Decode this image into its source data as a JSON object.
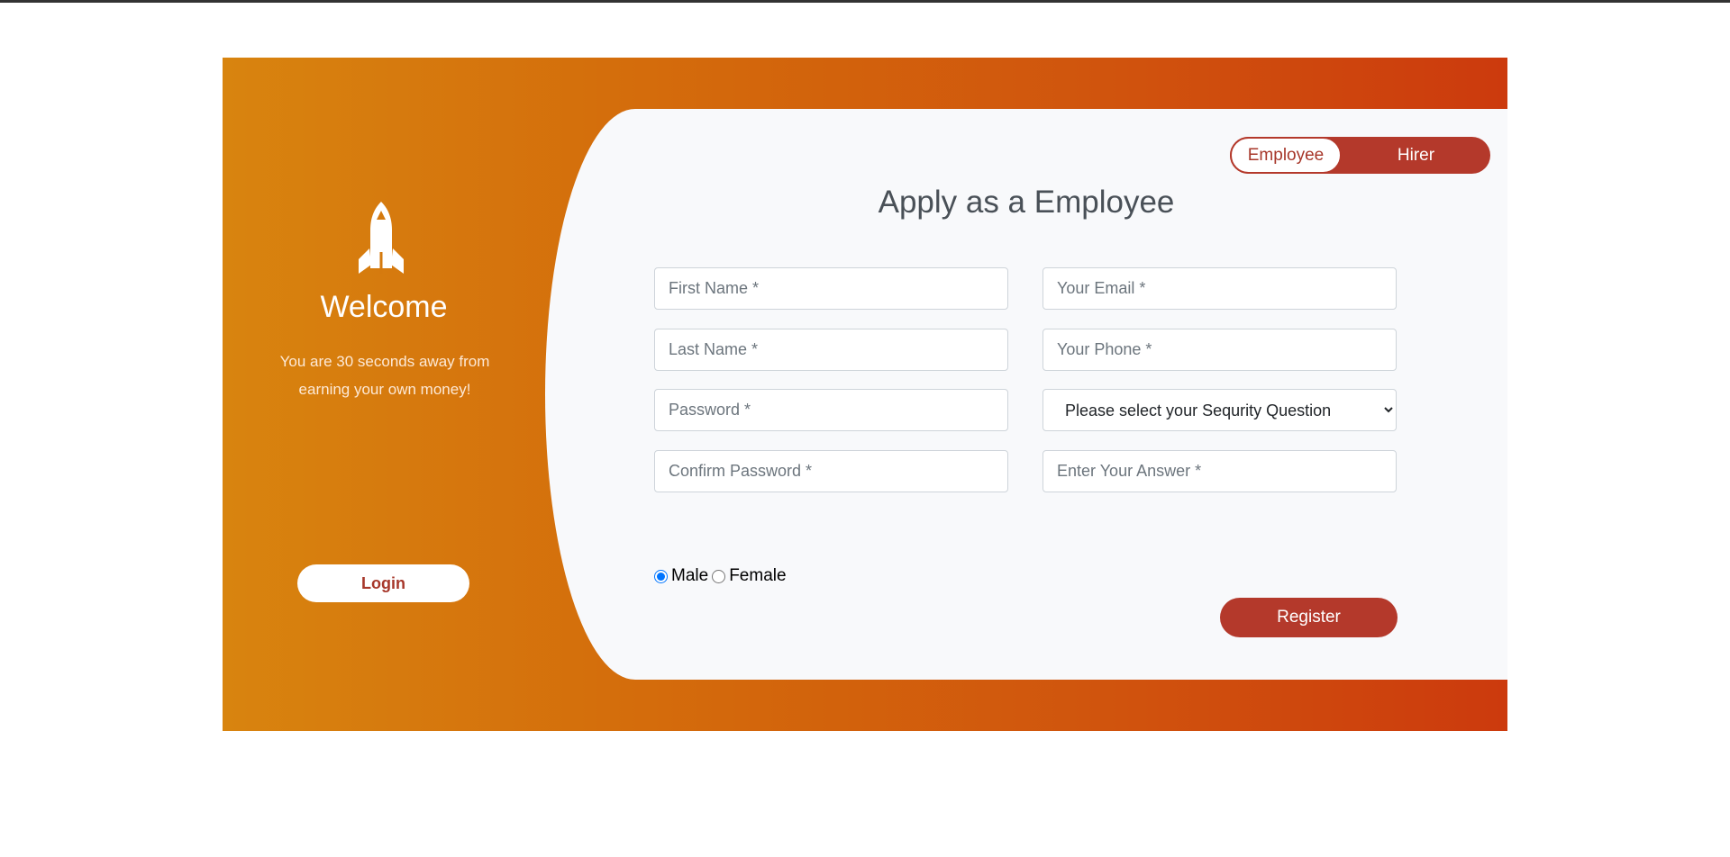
{
  "colors": {
    "accent": "#b4392b",
    "gradient_start": "#d8840f",
    "gradient_end": "#cc3a0d"
  },
  "left": {
    "icon": "rocket-icon",
    "welcome": "Welcome",
    "subtitle": "You are 30 seconds away from earning your own money!",
    "login_label": "Login"
  },
  "toggle": {
    "employee": "Employee",
    "hirer": "Hirer",
    "selected": "Employee"
  },
  "form": {
    "title": "Apply as a Employee",
    "first_name": "First Name *",
    "last_name": "Last Name *",
    "password": "Password *",
    "confirm_password": "Confirm Password *",
    "email": "Your Email *",
    "phone": "Your Phone *",
    "security_question": "Please select your Sequrity Question",
    "answer": "Enter Your Answer *",
    "gender": {
      "male": "Male",
      "female": "Female",
      "selected": "Male"
    },
    "register_label": "Register"
  }
}
